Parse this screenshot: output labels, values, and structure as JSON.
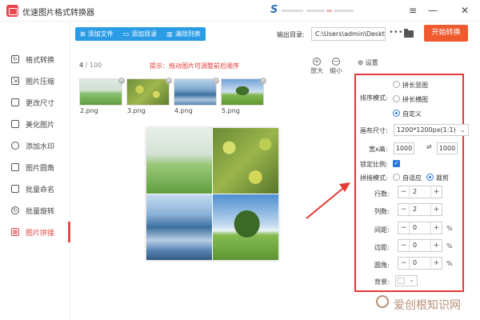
{
  "app": {
    "title": "优速图片格式转换器"
  },
  "window_controls": {
    "menu": "≡",
    "minimize": "—",
    "close": "✕"
  },
  "sidebar": {
    "items": [
      {
        "label": "格式转换",
        "icon": "convert-icon"
      },
      {
        "label": "图片压缩",
        "icon": "compress-icon"
      },
      {
        "label": "更改尺寸",
        "icon": "resize-icon"
      },
      {
        "label": "美化图片",
        "icon": "beautify-icon"
      },
      {
        "label": "添加水印",
        "icon": "watermark-icon"
      },
      {
        "label": "图片圆角",
        "icon": "round-corner-icon"
      },
      {
        "label": "批量命名",
        "icon": "rename-icon"
      },
      {
        "label": "批量旋转",
        "icon": "rotate-icon"
      },
      {
        "label": "图片拼接",
        "icon": "stitch-icon",
        "active": true
      }
    ]
  },
  "toolbar": {
    "add_file": "添加文件",
    "add_folder": "添加目录",
    "clear_list": "清除列表",
    "output_label": "输出目录:",
    "output_path": "C:\\Users\\admin\\Deskto",
    "more": "•••",
    "start": "开始转换"
  },
  "canvas": {
    "count": "4",
    "count_total": " / 100",
    "hint": "提示：拖动图片可调整前后顺序",
    "zoom_in": "放大",
    "zoom_out": "缩小",
    "thumbnails": [
      "2.png",
      "3.png",
      "4.png",
      "5.png"
    ]
  },
  "settings": {
    "title": "设置",
    "sort_label": "排序模式:",
    "sort_options": [
      "拼长竖图",
      "拼长横图",
      "自定义"
    ],
    "sort_selected": "自定义",
    "canvas_size_label": "画布尺寸:",
    "canvas_size_value": "1200*1200px(1:1)",
    "wh_label": "宽x高:",
    "width": "1000",
    "height": "1000",
    "lock_label": "锁定比例:",
    "lock_checked": true,
    "stitch_label": "拼接模式:",
    "stitch_options": [
      "自适应",
      "裁剪"
    ],
    "stitch_selected": "裁剪",
    "rows_label": "行数:",
    "rows": "2",
    "cols_label": "列数:",
    "cols": "2",
    "gap_label": "间距:",
    "gap": "0",
    "margin_label": "边距:",
    "margin": "0",
    "radius_label": "圆角:",
    "radius": "0",
    "unit_percent": "%",
    "bg_label": "背景:"
  },
  "watermark": {
    "text": "爱创根知识网"
  },
  "colors": {
    "accent": "#2a9ce6",
    "start": "#ef5b2f",
    "highlight": "#e53935",
    "active": "#e04b4b"
  }
}
